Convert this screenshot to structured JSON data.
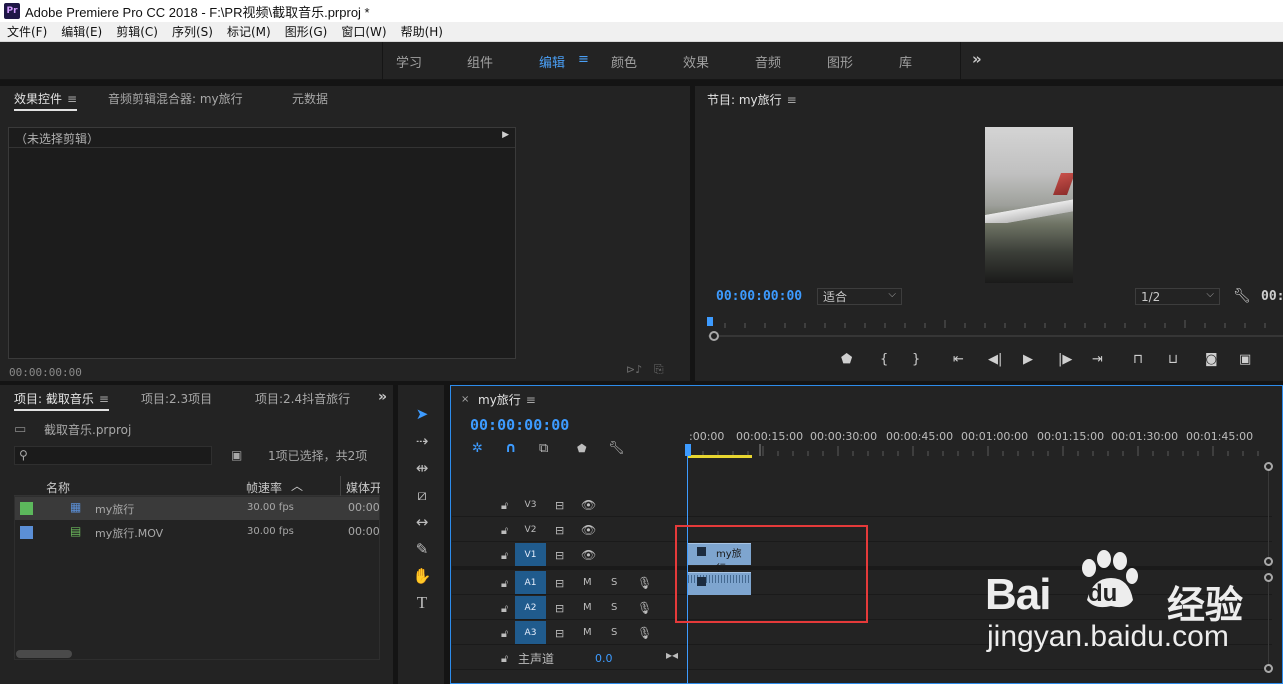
{
  "window": {
    "title": "Adobe Premiere Pro CC 2018 - F:\\PR视频\\截取音乐.prproj *",
    "logo": "Pr"
  },
  "menu": [
    "文件(F)",
    "编辑(E)",
    "剪辑(C)",
    "序列(S)",
    "标记(M)",
    "图形(G)",
    "窗口(W)",
    "帮助(H)"
  ],
  "workspaces": {
    "tabs": [
      "学习",
      "组件",
      "编辑",
      "颜色",
      "效果",
      "音频",
      "图形",
      "库"
    ],
    "active": "编辑",
    "more": "»"
  },
  "effect_panel": {
    "tabs": [
      "效果控件",
      "音频剪辑混合器: my旅行",
      "元数据"
    ],
    "no_clip": "（未选择剪辑）",
    "timecode": "00:00:00:00"
  },
  "program": {
    "title": "节目: my旅行",
    "timecode": "00:00:00:00",
    "fit": "适合",
    "resolution": "1/2",
    "timecode_right": "00:"
  },
  "project": {
    "tabs": [
      "项目: 截取音乐",
      "项目:2.3项目",
      "项目:2.4抖音旅行"
    ],
    "file": "截取音乐.prproj",
    "selection": "1项已选择，共2项",
    "columns": [
      "名称",
      "帧速率",
      "媒体开"
    ],
    "items": [
      {
        "name": "my旅行",
        "fps": "30.00 fps",
        "media": "00:00",
        "color": "#5cb85c"
      },
      {
        "name": "my旅行.MOV",
        "fps": "30.00 fps",
        "media": "00:00",
        "color": "#5b8fd6"
      }
    ]
  },
  "timeline": {
    "sequence": "my旅行",
    "timecode": "00:00:00:00",
    "ruler": [
      ":00:00",
      "00:00:15:00",
      "00:00:30:00",
      "00:00:45:00",
      "00:01:00:00",
      "00:01:15:00",
      "00:01:30:00",
      "00:01:45:00"
    ],
    "video_tracks": [
      "V3",
      "V2",
      "V1"
    ],
    "audio_tracks": [
      "A1",
      "A2",
      "A3"
    ],
    "mute_label": "M",
    "solo_label": "S",
    "master_label": "主声道",
    "master_value": "0.0",
    "clip_name": "my旅行"
  },
  "watermark": {
    "brand": "Bai",
    "du": "du",
    "cn": "经验",
    "url": "jingyan.baidu.com"
  }
}
